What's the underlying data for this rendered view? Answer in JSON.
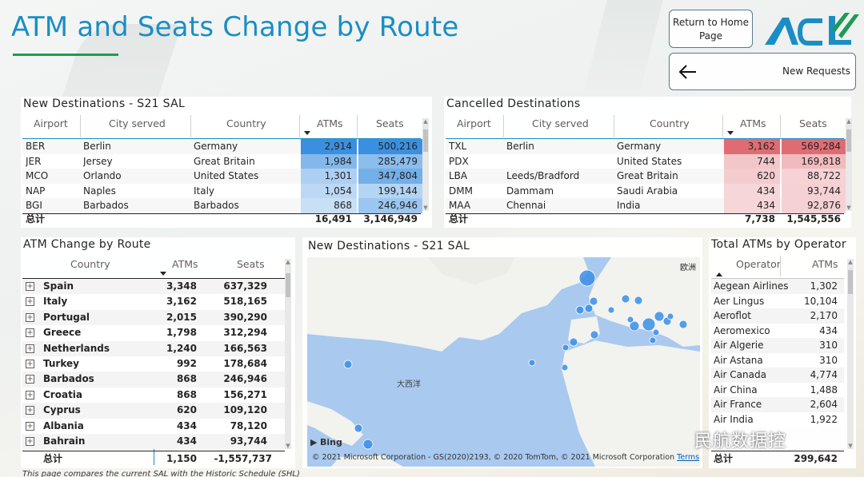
{
  "title": "ATM and Seats Change by Route",
  "buttons": {
    "home_line1": "Return to Home",
    "home_line2": "Page",
    "new_requests": "New Requests"
  },
  "new_destinations": {
    "title": "New Destinations - S21 SAL",
    "headers": [
      "Airport",
      "City served",
      "Country",
      "ATMs",
      "Seats"
    ],
    "rows": [
      {
        "airport": "BER",
        "city": "Berlin",
        "country": "Germany",
        "atms": "2,914",
        "seats": "500,216",
        "atm_level": 1.0,
        "seat_level": 1.0
      },
      {
        "airport": "JER",
        "city": "Jersey",
        "country": "Great Britain",
        "atms": "1,984",
        "seats": "285,479",
        "atm_level": 0.55,
        "seat_level": 0.5
      },
      {
        "airport": "MCO",
        "city": "Orlando",
        "country": "United States",
        "atms": "1,301",
        "seats": "347,804",
        "atm_level": 0.3,
        "seat_level": 0.65
      },
      {
        "airport": "NAP",
        "city": "Naples",
        "country": "Italy",
        "atms": "1,054",
        "seats": "199,144",
        "atm_level": 0.2,
        "seat_level": 0.25
      },
      {
        "airport": "BGI",
        "city": "Barbados",
        "country": "Barbados",
        "atms": "868",
        "seats": "246,946",
        "atm_level": 0.12,
        "seat_level": 0.4
      }
    ],
    "total_label": "总计",
    "total_atms": "16,491",
    "total_seats": "3,146,949"
  },
  "cancelled_destinations": {
    "title": "Cancelled Destinations",
    "headers": [
      "Airport",
      "City served",
      "Country",
      "ATMs",
      "Seats"
    ],
    "rows": [
      {
        "airport": "TXL",
        "city": "Berlin",
        "country": "Germany",
        "atms": "3,162",
        "seats": "569,284",
        "atm_level": 1.0,
        "seat_level": 1.0
      },
      {
        "airport": "PDX",
        "city": "",
        "country": "United States",
        "atms": "744",
        "seats": "169,818",
        "atm_level": 0.25,
        "seat_level": 0.35
      },
      {
        "airport": "LBA",
        "city": "Leeds/Bradford",
        "country": "Great Britain",
        "atms": "620",
        "seats": "88,722",
        "atm_level": 0.2,
        "seat_level": 0.15
      },
      {
        "airport": "DMM",
        "city": "Dammam",
        "country": "Saudi Arabia",
        "atms": "434",
        "seats": "93,744",
        "atm_level": 0.12,
        "seat_level": 0.16
      },
      {
        "airport": "MAA",
        "city": "Chennai",
        "country": "India",
        "atms": "434",
        "seats": "92,876",
        "atm_level": 0.12,
        "seat_level": 0.16
      }
    ],
    "total_label": "总计",
    "total_atms": "7,738",
    "total_seats": "1,545,556"
  },
  "atm_change": {
    "title": "ATM Change by Route",
    "headers": [
      "Country",
      "ATMs",
      "Seats"
    ],
    "rows": [
      {
        "country": "Spain",
        "atms": "3,348",
        "seats": "637,329"
      },
      {
        "country": "Italy",
        "atms": "3,162",
        "seats": "518,165"
      },
      {
        "country": "Portugal",
        "atms": "2,015",
        "seats": "390,290"
      },
      {
        "country": "Greece",
        "atms": "1,798",
        "seats": "312,294"
      },
      {
        "country": "Netherlands",
        "atms": "1,240",
        "seats": "166,563"
      },
      {
        "country": "Turkey",
        "atms": "992",
        "seats": "178,684"
      },
      {
        "country": "Barbados",
        "atms": "868",
        "seats": "246,946"
      },
      {
        "country": "Croatia",
        "atms": "868",
        "seats": "156,271"
      },
      {
        "country": "Cyprus",
        "atms": "620",
        "seats": "109,120"
      },
      {
        "country": "Albania",
        "atms": "434",
        "seats": "78,120"
      },
      {
        "country": "Bahrain",
        "atms": "434",
        "seats": "93,744"
      }
    ],
    "total_label": "总计",
    "total_atms": "1,150",
    "total_seats": "-1,557,737"
  },
  "map": {
    "title": "New Destinations - S21 SAL",
    "ocean_label": "大西洋",
    "continent_label": "欧洲",
    "bing": "Bing",
    "copyright": "© 2021 Microsoft Corporation - GS(2020)2193, © 2020 TomTom, © 2021 Microsoft Corporation",
    "terms": "Terms"
  },
  "operators": {
    "title": "Total ATMs by Operator",
    "headers": [
      "Operator",
      "ATMs"
    ],
    "rows": [
      {
        "operator": "Aegean Airlines",
        "atms": "1,302"
      },
      {
        "operator": "Aer Lingus",
        "atms": "10,104"
      },
      {
        "operator": "Aeroflot",
        "atms": "2,170"
      },
      {
        "operator": "Aeromexico",
        "atms": "434"
      },
      {
        "operator": "Air Algerie",
        "atms": "310"
      },
      {
        "operator": "Air Astana",
        "atms": "310"
      },
      {
        "operator": "Air Canada",
        "atms": "4,774"
      },
      {
        "operator": "Air China",
        "atms": "1,488"
      },
      {
        "operator": "Air France",
        "atms": "2,604"
      },
      {
        "operator": "Air India",
        "atms": "1,922"
      }
    ],
    "total_label": "总计",
    "total_atms": "299,642"
  },
  "footer": "This page compares the current SAL with the Historic Schedule (SHL)",
  "watermark": "民航数据控",
  "colors": {
    "title_blue": "#1a8ec4",
    "underline_green": "#1e9a56",
    "new_dest_blue": "#3b8fe0",
    "cancel_red": "#e06c73",
    "map_water": "#a9c9ef",
    "map_land": "#f2f2ef",
    "map_point": "#3a8ee8"
  }
}
